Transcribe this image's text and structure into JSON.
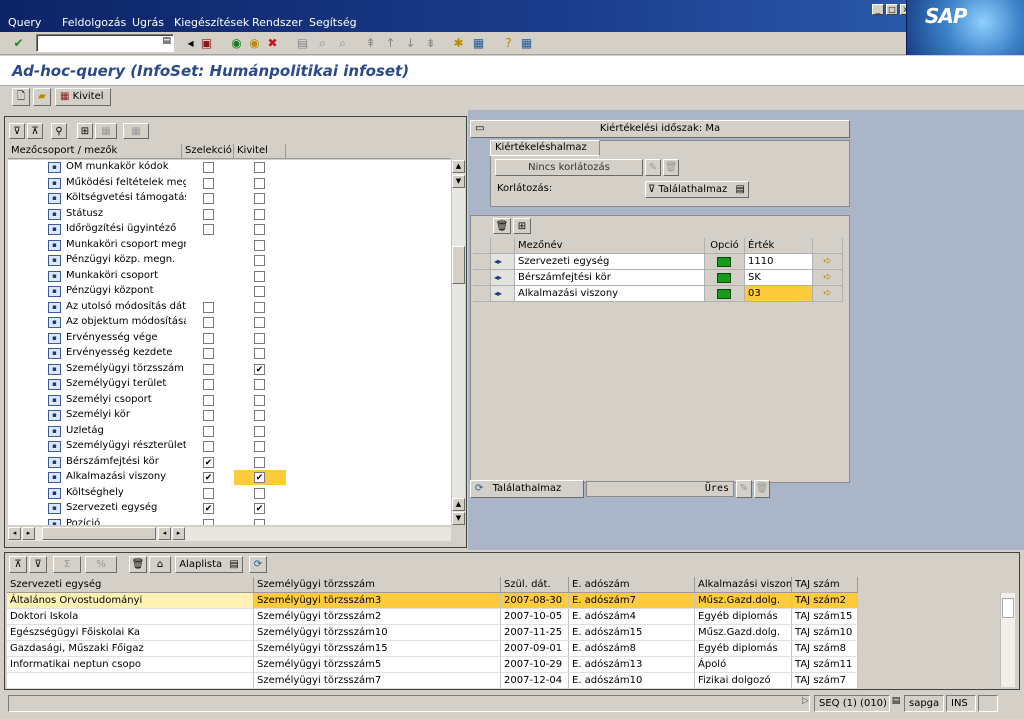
{
  "menu": [
    "Query",
    "Feldolgozás",
    "Ugrás",
    "Kiegészítések",
    "Rendszer",
    "Segítség"
  ],
  "sap_logo": "SAP",
  "title": "Ad-hoc-query (InfoSet: Humánpolitikai infoset)",
  "app_toolbar": {
    "kivitel": "Kivitel"
  },
  "tree": {
    "headers": {
      "name": "Mezőcsoport / mezők",
      "sel": "Szelekció",
      "out": "Kivitel"
    },
    "rows": [
      {
        "label": "OM munkakör kódok",
        "sel": false,
        "out": false,
        "hasSel": true
      },
      {
        "label": "Működési feltételek megá",
        "sel": false,
        "out": false,
        "hasSel": true
      },
      {
        "label": "Költségvetési támogatási",
        "sel": false,
        "out": false,
        "hasSel": true
      },
      {
        "label": "Státusz",
        "sel": false,
        "out": false,
        "hasSel": true
      },
      {
        "label": "Időrögzítési ügyintéző",
        "sel": false,
        "out": false,
        "hasSel": true
      },
      {
        "label": "Munkaköri csoport megn.",
        "sel": false,
        "out": false,
        "hasSel": false
      },
      {
        "label": "Pénzügyi közp. megn.",
        "sel": false,
        "out": false,
        "hasSel": false
      },
      {
        "label": "Munkaköri csoport",
        "sel": false,
        "out": false,
        "hasSel": false
      },
      {
        "label": "Pénzügyi központ",
        "sel": false,
        "out": false,
        "hasSel": false
      },
      {
        "label": "Az utolsó módosítás dátu",
        "sel": false,
        "out": false,
        "hasSel": true
      },
      {
        "label": "Az objektum módosításá",
        "sel": false,
        "out": false,
        "hasSel": true
      },
      {
        "label": "Érvényesség vége",
        "sel": false,
        "out": false,
        "hasSel": true
      },
      {
        "label": "Érvényesség kezdete",
        "sel": false,
        "out": false,
        "hasSel": true
      },
      {
        "label": "Személyügyi törzsszám",
        "sel": false,
        "out": true,
        "hasSel": true
      },
      {
        "label": "Személyügyi terület",
        "sel": false,
        "out": false,
        "hasSel": true
      },
      {
        "label": "Személyi csoport",
        "sel": false,
        "out": false,
        "hasSel": true
      },
      {
        "label": "Személyi kör",
        "sel": false,
        "out": false,
        "hasSel": true
      },
      {
        "label": "Üzletág",
        "sel": false,
        "out": false,
        "hasSel": true
      },
      {
        "label": "Személyügyi részterület",
        "sel": false,
        "out": false,
        "hasSel": true
      },
      {
        "label": "Bérszámfejtési kör",
        "sel": true,
        "out": false,
        "hasSel": true
      },
      {
        "label": "Alkalmazási viszony",
        "sel": true,
        "out": true,
        "hasSel": true,
        "hl": true
      },
      {
        "label": "Költséghely",
        "sel": false,
        "out": false,
        "hasSel": true
      },
      {
        "label": "Szervezeti egység",
        "sel": true,
        "out": true,
        "hasSel": true
      },
      {
        "label": "Pozíció",
        "sel": false,
        "out": false,
        "hasSel": true
      }
    ]
  },
  "eval_period": "Kiértékelési időszak: Ma",
  "hitset": {
    "tab": "Kiértékeléshalmaz",
    "no_restriction": "Nincs korlátozás",
    "restriction_label": "Korlátozás:",
    "restriction_value": "Találathalmaz"
  },
  "selgrid": {
    "headers": {
      "field": "Mezőnév",
      "option": "Opció",
      "value": "Érték"
    },
    "rows": [
      {
        "field": "Szervezeti egység",
        "value": "1110"
      },
      {
        "field": "Bérszámfejtési kör",
        "value": "SK"
      },
      {
        "field": "Alkalmazási viszony",
        "value": "03"
      }
    ]
  },
  "hitlist": {
    "button": "Találathalmaz",
    "status": "Üres"
  },
  "bottom_toolbar": {
    "layout": "Alaplista"
  },
  "result": {
    "headers": [
      "Szervezeti egység",
      "Személyügyi törzsszám",
      "Szül. dát.",
      "E. adószám",
      "Alkalmazási viszony",
      "TAJ szám"
    ],
    "rows": [
      [
        "Általános Orvostudományi",
        "Személyügyi törzsszám3",
        "2007-08-30",
        "E. adószám7",
        "Műsz.Gazd.dolg.",
        "TAJ szám2"
      ],
      [
        "Doktori Iskola",
        "Személyügyi törzsszám2",
        "2007-10-05",
        "E. adószám4",
        "Egyéb diplomás",
        "TAJ szám15"
      ],
      [
        "Egészségügyi Főiskolai Ka",
        "Személyügyi törzsszám10",
        "2007-11-25",
        "E. adószám15",
        "Műsz.Gazd.dolg.",
        "TAJ szám10"
      ],
      [
        "Gazdasági, Műszaki Főigaz",
        "Személyügyi törzsszám15",
        "2007-09-01",
        "E. adószám8",
        "Egyéb diplomás",
        "TAJ szám8"
      ],
      [
        "Informatikai neptun csopo",
        "Személyügyi törzsszám5",
        "2007-10-29",
        "E. adószám13",
        "Ápoló",
        "TAJ szám11"
      ],
      [
        "",
        "Személyügyi törzsszám7",
        "2007-12-04",
        "E. adószám10",
        "Fizikai dolgozó",
        "TAJ szám7"
      ]
    ]
  },
  "status": {
    "session": "SEQ (1) (010)",
    "server": "sapga",
    "mode": "INS"
  }
}
